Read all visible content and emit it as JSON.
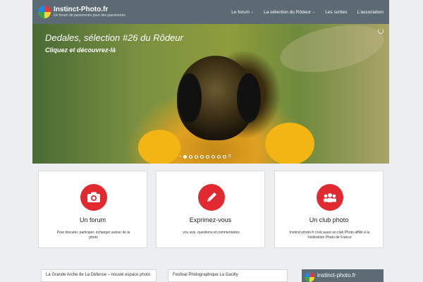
{
  "header": {
    "brand_title": "Instinct-Photo.fr",
    "brand_tagline": "Un forum de passionnés pour des passionnés",
    "nav": [
      {
        "label": "Le forum",
        "has_dropdown": true
      },
      {
        "label": "La sélection du Rôdeur",
        "has_dropdown": true
      },
      {
        "label": "Les sorties",
        "has_dropdown": false
      },
      {
        "label": "L'association",
        "has_dropdown": false
      }
    ]
  },
  "hero": {
    "title": "Dedales, sélection #26 du Rôdeur",
    "subtitle": "Cliquez et découvrez-là",
    "slide_prev": "›",
    "slide_pause": "II",
    "slide_count": 8,
    "active_slide": 1
  },
  "features": [
    {
      "icon": "camera-icon",
      "title": "Un forum",
      "text": "Pour discuter, participer, échanger autour de la photo"
    },
    {
      "icon": "pencil-icon",
      "title": "Exprimez-vous",
      "text": "vos avis, questions et commentaires"
    },
    {
      "icon": "group-icon",
      "title": "Un club photo",
      "text": "Instinct-photo.fr c'est aussi un club Photo affilié à la Fédération Photo de France"
    }
  ],
  "posts": [
    {
      "title": "La Grande Arche de La Défense – nouvel espace photo"
    },
    {
      "title": "Festival Photographique La Gacilly"
    }
  ],
  "widget": {
    "label": "instinct-photo.fr"
  },
  "colors": {
    "header_bg": "#5b6a73",
    "accent": "#e12a2f",
    "page_bg": "#eceeef"
  }
}
